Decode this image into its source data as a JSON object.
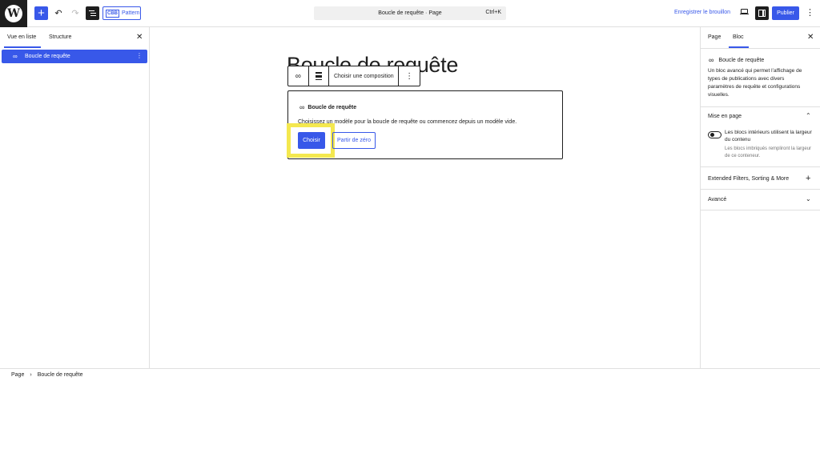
{
  "topbar": {
    "add_label": "+",
    "pattern_icon_text": "CBB",
    "pattern_label": "Pattern",
    "command_title": "Boucle de requête · Page",
    "command_shortcut": "Ctrl+K",
    "save_draft": "Enregistrer le brouillon",
    "publish": "Publier",
    "icons": [
      "wordpress-logo",
      "plus",
      "undo",
      "redo",
      "list-view",
      "desktop-view",
      "settings",
      "more-vertical"
    ]
  },
  "left_panel": {
    "tabs": [
      {
        "label": "Vue en liste",
        "active": true
      },
      {
        "label": "Structure",
        "active": false
      }
    ],
    "items": [
      {
        "label": "Boucle de requête",
        "selected": true
      }
    ]
  },
  "canvas": {
    "page_title": "Boucle de requête",
    "toolbar": {
      "choose_pattern": "Choisir une composition"
    },
    "placeholder": {
      "title": "Boucle de requête",
      "description": "Choisissez un modèle pour la boucle de requête ou commencez depuis un modèle vide.",
      "choose_button": "Choisir",
      "start_blank_button": "Partir de zéro"
    }
  },
  "right_panel": {
    "tabs": [
      {
        "label": "Page",
        "active": false
      },
      {
        "label": "Bloc",
        "active": true
      }
    ],
    "block_name": "Boucle de requête",
    "block_description": "Un bloc avancé qui permet l’affichage de types de publications avec divers paramètres de requête et configurations visuelles.",
    "sections": [
      {
        "title": "Mise en page",
        "expanded": true
      },
      {
        "title": "Extended Filters, Sorting & More",
        "expanded": false
      },
      {
        "title": "Avancé",
        "expanded": false
      }
    ],
    "toggle_label": "Les blocs intérieurs utilisent la largeur du contenu",
    "toggle_help": "Les blocs imbriqués rempliront la largeur de ce conteneur.",
    "toggle_on": false
  },
  "footer": {
    "breadcrumb": [
      "Page",
      "Boucle de requête"
    ]
  },
  "colors": {
    "accent": "#3858e9",
    "dark": "#1e1e1e",
    "highlight": "#f4e84f"
  }
}
